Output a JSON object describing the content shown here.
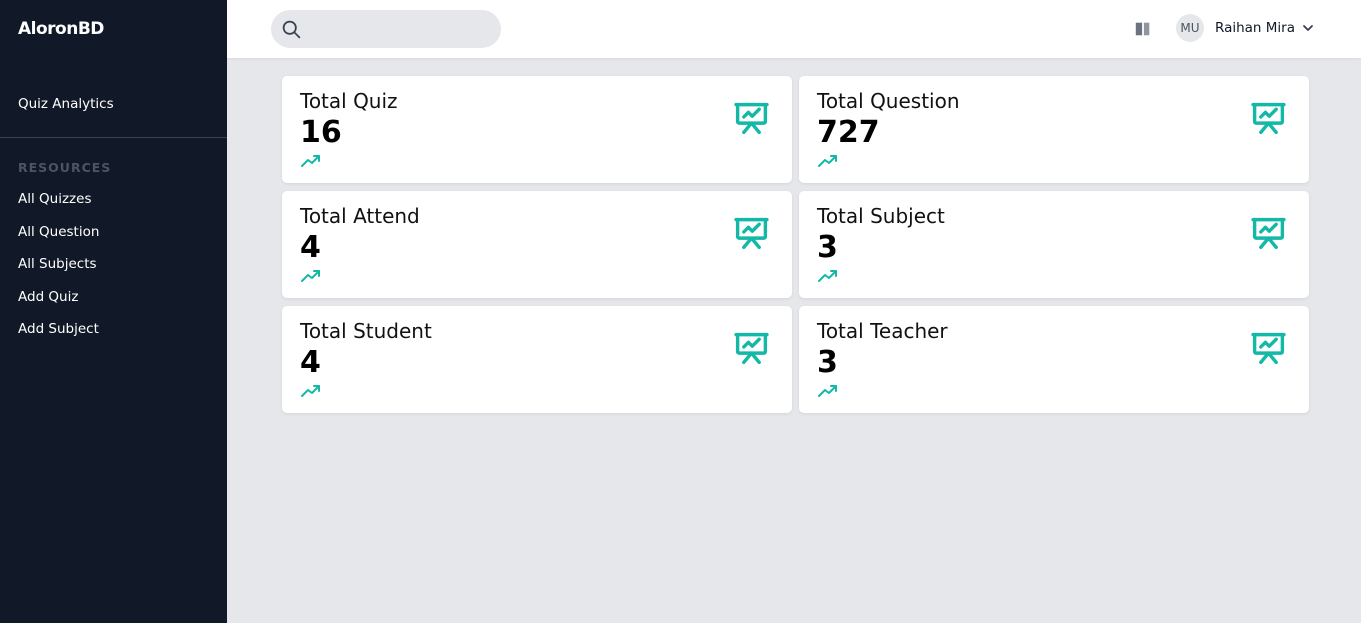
{
  "brand": "AloronBD",
  "nav": {
    "primary": "Quiz Analytics",
    "section_label": "RESOURCES",
    "items": [
      {
        "label": "All Quizzes"
      },
      {
        "label": "All Question"
      },
      {
        "label": "All Subjects"
      },
      {
        "label": "Add Quiz"
      },
      {
        "label": "Add Subject"
      }
    ]
  },
  "header": {
    "search_placeholder": "",
    "user": {
      "initials": "MU",
      "name": "Raihan Mira"
    }
  },
  "cards": [
    {
      "title": "Total Quiz",
      "value": "16"
    },
    {
      "title": "Total Question",
      "value": "727"
    },
    {
      "title": "Total Attend",
      "value": "4"
    },
    {
      "title": "Total Subject",
      "value": "3"
    },
    {
      "title": "Total Student",
      "value": "4"
    },
    {
      "title": "Total Teacher",
      "value": "3"
    }
  ],
  "colors": {
    "sidebar_bg": "#111827",
    "accent": "#14b8a6",
    "page_bg": "#e5e7eb"
  },
  "icons": {
    "search": "search-icon",
    "book": "book-icon",
    "chevron": "chevron-down-icon",
    "card_board": "presentation-chart-icon",
    "card_trend": "trending-up-icon"
  }
}
